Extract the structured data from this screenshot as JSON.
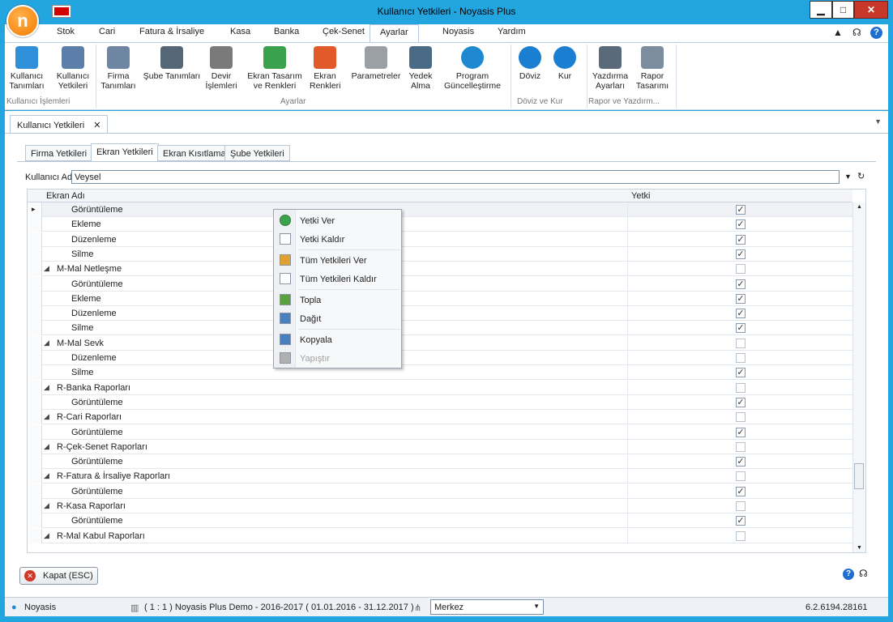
{
  "window": {
    "title": "Kullanıcı Yetkileri - Noyasis Plus",
    "buttons": {
      "minimize": "▁",
      "maximize": "□",
      "close": "✕"
    }
  },
  "ribbon": {
    "tabs": [
      "Stok",
      "Cari",
      "Fatura & İrsaliye",
      "Kasa",
      "Banka",
      "Çek-Senet",
      "Ayarlar",
      "Noyasis",
      "Yardım"
    ],
    "active_tab": "Ayarlar",
    "buttons": [
      {
        "l1": "Kullanıcı",
        "l2": "Tanımları",
        "color": "#2f8fd8",
        "icon": "user-icon"
      },
      {
        "l1": "Kullanıcı",
        "l2": "Yetkileri",
        "color": "#5b7fa8",
        "icon": "user-permissions-icon"
      },
      {
        "l1": "Firma",
        "l2": "Tanımları",
        "color": "#6f86a3",
        "icon": "building-icon"
      },
      {
        "l1": "Şube Tanımları",
        "l2": "",
        "color": "#556677",
        "icon": "org-chart-icon"
      },
      {
        "l1": "Devir",
        "l2": "İşlemleri",
        "color": "#7a7a7a",
        "icon": "transfer-icon"
      },
      {
        "l1": "Ekran Tasarım",
        "l2": "ve Renkleri",
        "color": "#3aa24d",
        "icon": "screen-design-icon"
      },
      {
        "l1": "Ekran",
        "l2": "Renkleri",
        "color": "#e25a2a",
        "icon": "palette-icon"
      },
      {
        "l1": "Parametreler",
        "l2": "",
        "color": "#9aa0a6",
        "icon": "gear-icon"
      },
      {
        "l1": "Yedek",
        "l2": "Alma",
        "color": "#4a6a86",
        "icon": "database-icon"
      },
      {
        "l1": "Program",
        "l2": "Güncelleştirme",
        "color": "#1e88d0",
        "icon": "update-icon"
      },
      {
        "l1": "Döviz",
        "l2": "",
        "color": "#1b7fd1",
        "icon": "euro-icon"
      },
      {
        "l1": "Kur",
        "l2": "",
        "color": "#1b7fd1",
        "icon": "dollar-icon"
      },
      {
        "l1": "Yazdırma",
        "l2": "Ayarları",
        "color": "#5a6a7a",
        "icon": "printer-icon"
      },
      {
        "l1": "Rapor",
        "l2": "Tasarımı",
        "color": "#7d8da0",
        "icon": "report-design-icon"
      }
    ],
    "groups": [
      "Kullanıcı İşlemleri",
      "Ayarlar",
      "Döviz ve Kur",
      "Rapor ve Yazdırm..."
    ]
  },
  "doc_tab": {
    "label": "Kullanıcı Yetkileri",
    "close": "✕"
  },
  "inner_tabs": [
    "Firma Yetkileri",
    "Ekran Yetkileri",
    "Ekran Kısıtlama",
    "Şube Yetkileri"
  ],
  "active_inner_tab": "Ekran Yetkileri",
  "user": {
    "label": "Kullanıcı Adı",
    "value": "Veysel"
  },
  "grid": {
    "columns": [
      "Ekran Adı",
      "Yetki"
    ],
    "rows": [
      {
        "name": "Görüntüleme",
        "level": 2,
        "checked": true,
        "selected": true
      },
      {
        "name": "Ekleme",
        "level": 2,
        "checked": true
      },
      {
        "name": "Düzenleme",
        "level": 2,
        "checked": true
      },
      {
        "name": "Silme",
        "level": 2,
        "checked": true
      },
      {
        "name": "M-Mal Netleşme",
        "level": 1,
        "checked": false
      },
      {
        "name": "Görüntüleme",
        "level": 2,
        "checked": true
      },
      {
        "name": "Ekleme",
        "level": 2,
        "checked": true
      },
      {
        "name": "Düzenleme",
        "level": 2,
        "checked": true
      },
      {
        "name": "Silme",
        "level": 2,
        "checked": true
      },
      {
        "name": "M-Mal Sevk",
        "level": 1,
        "checked": false
      },
      {
        "name": "Düzenleme",
        "level": 2,
        "checked": false
      },
      {
        "name": "Silme",
        "level": 2,
        "checked": true
      },
      {
        "name": "R-Banka Raporları",
        "level": 1,
        "checked": false
      },
      {
        "name": "Görüntüleme",
        "level": 2,
        "checked": true
      },
      {
        "name": "R-Cari Raporları",
        "level": 1,
        "checked": false
      },
      {
        "name": "Görüntüleme",
        "level": 2,
        "checked": true
      },
      {
        "name": "R-Çek-Senet Raporları",
        "level": 1,
        "checked": false
      },
      {
        "name": "Görüntüleme",
        "level": 2,
        "checked": true
      },
      {
        "name": "R-Fatura & İrsaliye Raporları",
        "level": 1,
        "checked": false
      },
      {
        "name": "Görüntüleme",
        "level": 2,
        "checked": true
      },
      {
        "name": "R-Kasa  Raporları",
        "level": 1,
        "checked": false
      },
      {
        "name": "Görüntüleme",
        "level": 2,
        "checked": true
      },
      {
        "name": "R-Mal Kabul Raporları",
        "level": 1,
        "checked": false
      }
    ]
  },
  "context_menu": [
    {
      "label": "Yetki Ver",
      "icon": "check-icon",
      "color": "#3aa24d",
      "enabled": true
    },
    {
      "label": "Yetki Kaldır",
      "icon": "empty-box-icon",
      "color": "#ffffff",
      "enabled": true
    },
    {
      "sep": true
    },
    {
      "label": "Tüm Yetkileri Ver",
      "icon": "checklist-icon",
      "color": "#e0a030",
      "enabled": true
    },
    {
      "label": "Tüm Yetkileri Kaldır",
      "icon": "empty-box-icon",
      "color": "#ffffff",
      "enabled": true
    },
    {
      "sep": true
    },
    {
      "label": "Topla",
      "icon": "collapse-icon",
      "color": "#5aa040",
      "enabled": true
    },
    {
      "label": "Dağıt",
      "icon": "expand-icon",
      "color": "#4a80c0",
      "enabled": true
    },
    {
      "sep": true
    },
    {
      "label": "Kopyala",
      "icon": "copy-icon",
      "color": "#4a80c0",
      "enabled": true
    },
    {
      "label": "Yapıştır",
      "icon": "paste-icon",
      "color": "#b0b0b0",
      "enabled": false
    }
  ],
  "footer": {
    "close_label": "Kapat (ESC)"
  },
  "status": {
    "user": "Noyasis",
    "db": "( 1 : 1 )  Noyasis Plus Demo - 2016-2017  ( 01.01.2016 - 31.12.2017 )",
    "branch": "Merkez",
    "version": "6.2.6194.28161"
  },
  "colors": {
    "frame": "#23a6e0",
    "accent": "#1e88d0"
  }
}
